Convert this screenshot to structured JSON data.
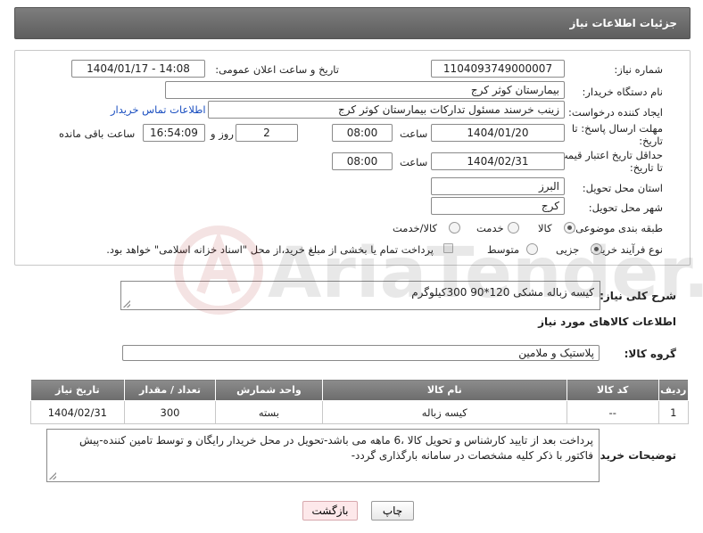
{
  "header": {
    "title": "جزئیات اطلاعات نیاز"
  },
  "form": {
    "need_number": {
      "label": "شماره نیاز:",
      "value": "1104093749000007"
    },
    "announce_datetime": {
      "label": "تاریخ و ساعت اعلان عمومی:",
      "value": "1404/01/17 - 14:08"
    },
    "buyer_org": {
      "label": "نام دستگاه خریدار:",
      "value": "بیمارستان کوثر کرج"
    },
    "requester": {
      "label": "ایجاد کننده درخواست:",
      "value": "زینب خرسند مسئول تدارکات بیمارستان کوثر کرج",
      "contact_link": "اطلاعات تماس خریدار"
    },
    "reply_deadline": {
      "label": "مهلت ارسال پاسخ: تا تاریخ:",
      "date": "1404/01/20",
      "time_label": "ساعت",
      "time": "08:00",
      "days": "2",
      "days_label": "روز و",
      "remaining_time": "16:54:09",
      "remaining_label": "ساعت باقی مانده"
    },
    "price_validity": {
      "label": "حداقل تاریخ اعتبار قیمت: تا تاریخ:",
      "date": "1404/02/31",
      "time_label": "ساعت",
      "time": "08:00"
    },
    "delivery_province": {
      "label": "استان محل تحویل:",
      "value": "البرز"
    },
    "delivery_city": {
      "label": "شهر محل تحویل:",
      "value": "کرج"
    },
    "category": {
      "label": "طبقه بندی موضوعی:",
      "options": [
        "کالا",
        "خدمت",
        "کالا/خدمت"
      ]
    },
    "purchase_process": {
      "label": "نوع فرآیند خرید :",
      "options": [
        "جزیی",
        "متوسط"
      ],
      "note": "پرداخت تمام یا بخشی از مبلغ خرید،از محل \"اسناد خزانه اسلامی\" خواهد بود."
    }
  },
  "need_summary": {
    "label": "شرح کلی نیاز:",
    "value": "کیسه زباله مشکی 120*90  300کیلوگرم"
  },
  "goods_section": {
    "title": "اطلاعات کالاهای مورد نیاز"
  },
  "goods_group": {
    "label": "گروه کالا:",
    "value": "پلاستیک و ملامین"
  },
  "table": {
    "headers": [
      "ردیف",
      "کد کالا",
      "نام کالا",
      "واحد شمارش",
      "تعداد / مقدار",
      "تاریخ نیاز"
    ],
    "rows": [
      [
        "1",
        "--",
        "کیسه زباله",
        "بسته",
        "300",
        "1404/02/31"
      ]
    ]
  },
  "buyer_notes": {
    "label": "توضیحات خریدار:",
    "value": "پرداخت بعد از تایید کارشناس و تحویل کالا ،6 ماهه می باشد-تحویل در محل خریدار رایگان و توسط تامین کننده-پیش فاکتور با ذکر کلیه مشخصات در سامانه بارگذاری گردد-"
  },
  "buttons": {
    "print": "چاپ",
    "back": "بازگشت"
  },
  "watermark": {
    "text": "AriaTender.net"
  },
  "colors": {
    "header_bg": "#6e6e6e",
    "link": "#1a4ec0",
    "back_button_bg": "#fde8ea"
  }
}
